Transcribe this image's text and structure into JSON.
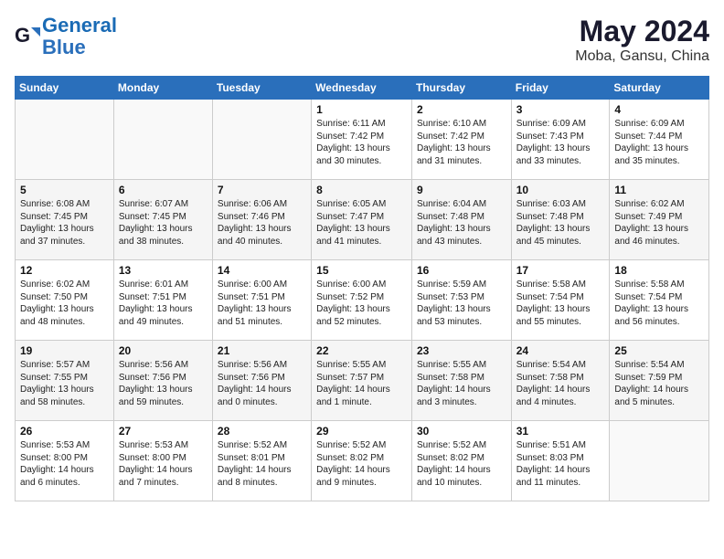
{
  "header": {
    "logo_line1": "General",
    "logo_line2": "Blue",
    "main_title": "May 2024",
    "subtitle": "Moba, Gansu, China"
  },
  "weekdays": [
    "Sunday",
    "Monday",
    "Tuesday",
    "Wednesday",
    "Thursday",
    "Friday",
    "Saturday"
  ],
  "weeks": [
    [
      {
        "day": "",
        "info": ""
      },
      {
        "day": "",
        "info": ""
      },
      {
        "day": "",
        "info": ""
      },
      {
        "day": "1",
        "info": "Sunrise: 6:11 AM\nSunset: 7:42 PM\nDaylight: 13 hours\nand 30 minutes."
      },
      {
        "day": "2",
        "info": "Sunrise: 6:10 AM\nSunset: 7:42 PM\nDaylight: 13 hours\nand 31 minutes."
      },
      {
        "day": "3",
        "info": "Sunrise: 6:09 AM\nSunset: 7:43 PM\nDaylight: 13 hours\nand 33 minutes."
      },
      {
        "day": "4",
        "info": "Sunrise: 6:09 AM\nSunset: 7:44 PM\nDaylight: 13 hours\nand 35 minutes."
      }
    ],
    [
      {
        "day": "5",
        "info": "Sunrise: 6:08 AM\nSunset: 7:45 PM\nDaylight: 13 hours\nand 37 minutes."
      },
      {
        "day": "6",
        "info": "Sunrise: 6:07 AM\nSunset: 7:45 PM\nDaylight: 13 hours\nand 38 minutes."
      },
      {
        "day": "7",
        "info": "Sunrise: 6:06 AM\nSunset: 7:46 PM\nDaylight: 13 hours\nand 40 minutes."
      },
      {
        "day": "8",
        "info": "Sunrise: 6:05 AM\nSunset: 7:47 PM\nDaylight: 13 hours\nand 41 minutes."
      },
      {
        "day": "9",
        "info": "Sunrise: 6:04 AM\nSunset: 7:48 PM\nDaylight: 13 hours\nand 43 minutes."
      },
      {
        "day": "10",
        "info": "Sunrise: 6:03 AM\nSunset: 7:48 PM\nDaylight: 13 hours\nand 45 minutes."
      },
      {
        "day": "11",
        "info": "Sunrise: 6:02 AM\nSunset: 7:49 PM\nDaylight: 13 hours\nand 46 minutes."
      }
    ],
    [
      {
        "day": "12",
        "info": "Sunrise: 6:02 AM\nSunset: 7:50 PM\nDaylight: 13 hours\nand 48 minutes."
      },
      {
        "day": "13",
        "info": "Sunrise: 6:01 AM\nSunset: 7:51 PM\nDaylight: 13 hours\nand 49 minutes."
      },
      {
        "day": "14",
        "info": "Sunrise: 6:00 AM\nSunset: 7:51 PM\nDaylight: 13 hours\nand 51 minutes."
      },
      {
        "day": "15",
        "info": "Sunrise: 6:00 AM\nSunset: 7:52 PM\nDaylight: 13 hours\nand 52 minutes."
      },
      {
        "day": "16",
        "info": "Sunrise: 5:59 AM\nSunset: 7:53 PM\nDaylight: 13 hours\nand 53 minutes."
      },
      {
        "day": "17",
        "info": "Sunrise: 5:58 AM\nSunset: 7:54 PM\nDaylight: 13 hours\nand 55 minutes."
      },
      {
        "day": "18",
        "info": "Sunrise: 5:58 AM\nSunset: 7:54 PM\nDaylight: 13 hours\nand 56 minutes."
      }
    ],
    [
      {
        "day": "19",
        "info": "Sunrise: 5:57 AM\nSunset: 7:55 PM\nDaylight: 13 hours\nand 58 minutes."
      },
      {
        "day": "20",
        "info": "Sunrise: 5:56 AM\nSunset: 7:56 PM\nDaylight: 13 hours\nand 59 minutes."
      },
      {
        "day": "21",
        "info": "Sunrise: 5:56 AM\nSunset: 7:56 PM\nDaylight: 14 hours\nand 0 minutes."
      },
      {
        "day": "22",
        "info": "Sunrise: 5:55 AM\nSunset: 7:57 PM\nDaylight: 14 hours\nand 1 minute."
      },
      {
        "day": "23",
        "info": "Sunrise: 5:55 AM\nSunset: 7:58 PM\nDaylight: 14 hours\nand 3 minutes."
      },
      {
        "day": "24",
        "info": "Sunrise: 5:54 AM\nSunset: 7:58 PM\nDaylight: 14 hours\nand 4 minutes."
      },
      {
        "day": "25",
        "info": "Sunrise: 5:54 AM\nSunset: 7:59 PM\nDaylight: 14 hours\nand 5 minutes."
      }
    ],
    [
      {
        "day": "26",
        "info": "Sunrise: 5:53 AM\nSunset: 8:00 PM\nDaylight: 14 hours\nand 6 minutes."
      },
      {
        "day": "27",
        "info": "Sunrise: 5:53 AM\nSunset: 8:00 PM\nDaylight: 14 hours\nand 7 minutes."
      },
      {
        "day": "28",
        "info": "Sunrise: 5:52 AM\nSunset: 8:01 PM\nDaylight: 14 hours\nand 8 minutes."
      },
      {
        "day": "29",
        "info": "Sunrise: 5:52 AM\nSunset: 8:02 PM\nDaylight: 14 hours\nand 9 minutes."
      },
      {
        "day": "30",
        "info": "Sunrise: 5:52 AM\nSunset: 8:02 PM\nDaylight: 14 hours\nand 10 minutes."
      },
      {
        "day": "31",
        "info": "Sunrise: 5:51 AM\nSunset: 8:03 PM\nDaylight: 14 hours\nand 11 minutes."
      },
      {
        "day": "",
        "info": ""
      }
    ]
  ]
}
